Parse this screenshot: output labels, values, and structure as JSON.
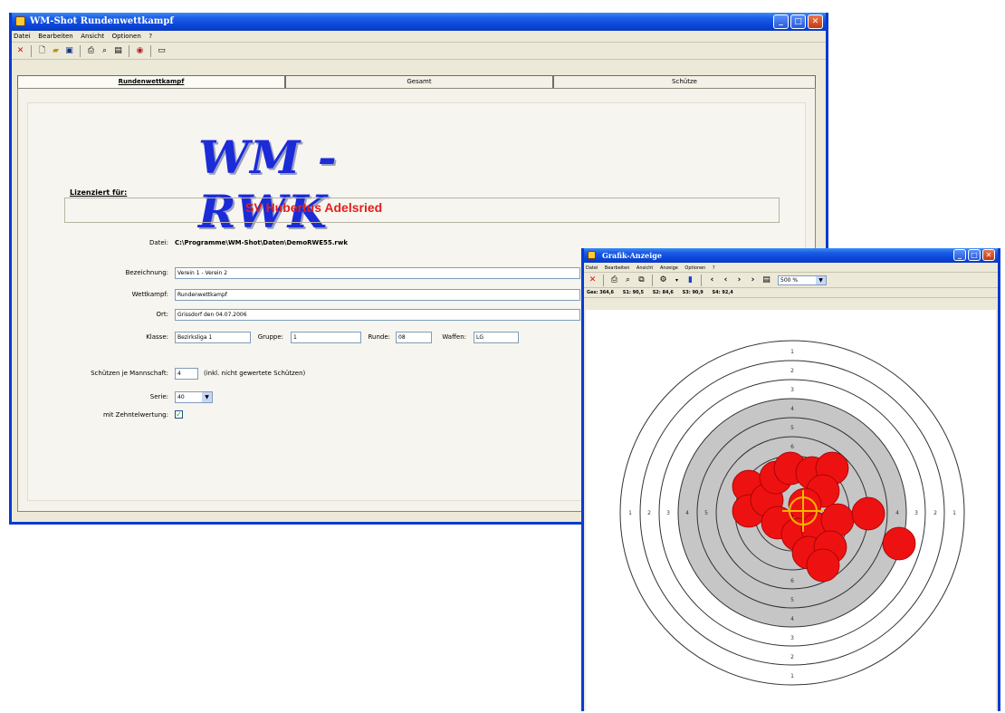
{
  "main_window": {
    "title": "WM-Shot Rundenwettkampf",
    "menu": [
      "Datei",
      "Bearbeiten",
      "Ansicht",
      "Optionen",
      "?"
    ],
    "tabs": [
      "Rundenwettkampf",
      "Gesamt",
      "Schütze"
    ],
    "logo_text": "WM - RWK",
    "license_label": "Lizenziert für:",
    "license_name": "SV Hubertus Adelsried",
    "file_label": "Datei:",
    "file_value": "C:\\Programme\\WM-Shot\\Daten\\DemoRWE55.rwk",
    "form": {
      "bezeichnung_label": "Bezeichnung:",
      "bezeichnung_value": "Verein 1 - Verein 2",
      "wettkampf_label": "Wettkampf:",
      "wettkampf_value": "Rundenwettkampf",
      "ort_label": "Ort:",
      "ort_value": "Grissdorf den 04.07.2006",
      "klasse_label": "Klasse:",
      "klasse_value": "Bezirksliga 1",
      "gruppe_label": "Gruppe:",
      "gruppe_value": "1",
      "runde_label": "Runde:",
      "runde_value": "08",
      "waffen_label": "Waffen:",
      "waffen_value": "LG",
      "schuetzen_label": "Schützen je Mannschaft:",
      "schuetzen_value": "4",
      "schuetzen_note": "(inkl. nicht gewertete Schützen)",
      "serie_label": "Serie:",
      "serie_value": "40",
      "zehntel_label": "mit Zehntelwertung:",
      "zehntel_checked": true
    }
  },
  "graphics_window": {
    "title": "Grafik-Anzeige",
    "menu": [
      "Datei",
      "Bearbeiten",
      "Ansicht",
      "Anzeige",
      "Optionen",
      "?"
    ],
    "zoom_value": "500 %",
    "status": [
      "Ges: 364,6",
      "S1: 90,5",
      "S2: 84,6",
      "S3: 90,9",
      "S4: 92,4"
    ],
    "ring_numbers_top": [
      "1",
      "2",
      "3",
      "4",
      "5",
      "6"
    ],
    "ring_numbers_bottom": [
      "6",
      "5",
      "4",
      "3",
      "2",
      "1"
    ],
    "ring_numbers_left": [
      "1",
      "2",
      "3",
      "4",
      "5"
    ],
    "ring_numbers_right": [
      "4",
      "3",
      "2",
      "1"
    ],
    "colors": {
      "shot": "#ee1111",
      "crosshair": "#f5b400",
      "target_gray": "#c6c6c6"
    }
  }
}
